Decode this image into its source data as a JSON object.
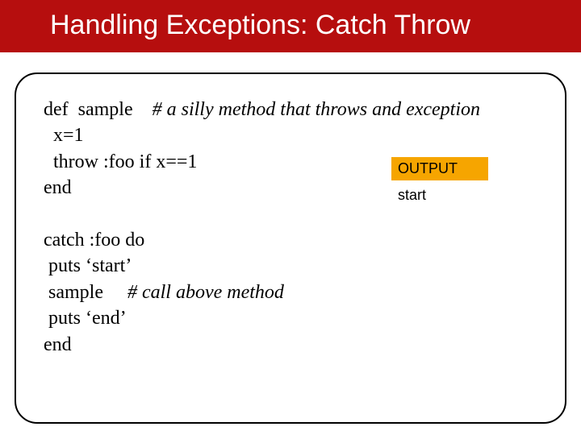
{
  "title": "Handling Exceptions:  Catch Throw",
  "code": {
    "l1a": "def  sample    ",
    "l1b": "# a silly method that throws and exception",
    "l2": "  x=1",
    "l3": "  throw :foo if x==1",
    "l4": "end",
    "blank": "",
    "l5": "catch :foo do",
    "l6": " puts ‘start’",
    "l7a": " sample     ",
    "l7b": "# call above method",
    "l8": " puts ‘end’",
    "l9": "end"
  },
  "output": {
    "label": "OUTPUT",
    "value": "start"
  }
}
